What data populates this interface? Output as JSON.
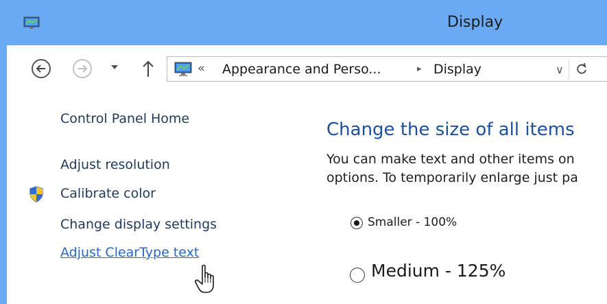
{
  "window": {
    "title": "Display"
  },
  "nav": {
    "address": {
      "chevron": "«",
      "crumb1": "Appearance and Perso...",
      "separator": "▸",
      "crumb2": "Display",
      "dropdown": "∨"
    }
  },
  "sidebar": {
    "items": [
      {
        "label": "Control Panel Home"
      },
      {
        "label": "Adjust resolution"
      },
      {
        "label": "Calibrate color"
      },
      {
        "label": "Change display settings"
      },
      {
        "label": "Adjust ClearType text"
      }
    ]
  },
  "main": {
    "heading": "Change the size of all items",
    "description_line1": "You can make text and other items on",
    "description_line2": "options. To temporarily enlarge just pa",
    "options": [
      {
        "label": "Smaller - 100%",
        "selected": true
      },
      {
        "label": "Medium - 125%",
        "selected": false
      }
    ]
  },
  "colors": {
    "titlebar": "#6aaaf5",
    "heading": "#1e4f9e",
    "link": "#2b65c9"
  }
}
